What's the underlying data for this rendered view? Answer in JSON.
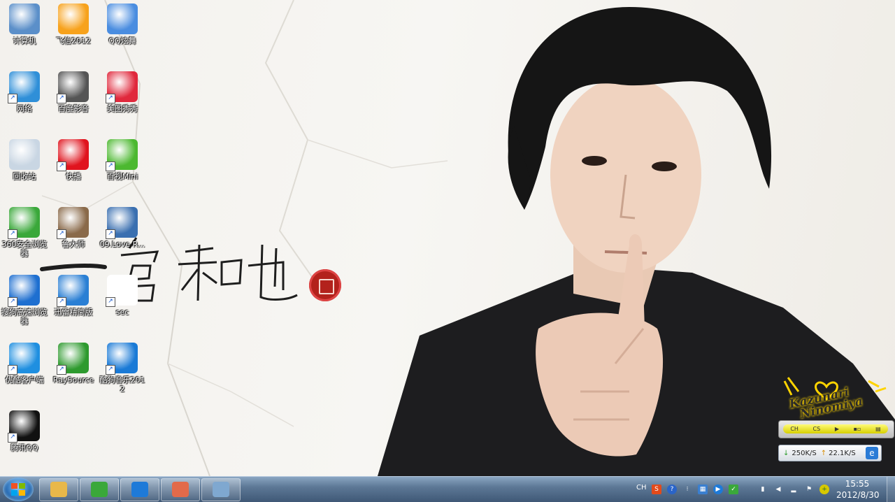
{
  "desktop": {
    "icons": [
      {
        "label": "计算机",
        "icon": "computer-icon",
        "color": "#5b8fc9"
      },
      {
        "label": "飞信2012",
        "icon": "fetion-icon",
        "color": "#f7a21c"
      },
      {
        "label": "QQ炫舞",
        "icon": "qq-dance-icon",
        "color": "#4a8de0"
      },
      {
        "label": "网络",
        "icon": "network-icon",
        "color": "#2f8fd8"
      },
      {
        "label": "百度影音",
        "icon": "baidu-player-icon",
        "color": "#555555"
      },
      {
        "label": "美图秀秀",
        "icon": "meitu-icon",
        "color": "#e0283c"
      },
      {
        "label": "回收站",
        "icon": "recycle-bin-icon",
        "color": "#c9d6e3"
      },
      {
        "label": "快播",
        "icon": "qvod-icon",
        "color": "#e0141e"
      },
      {
        "label": "百视Mini",
        "icon": "media-mini-icon",
        "color": "#4cb830"
      },
      {
        "label": "360安全浏览器",
        "icon": "browser-360-icon",
        "color": "#3aa83a"
      },
      {
        "label": "鲁大师",
        "icon": "ludashi-icon",
        "color": "#8a6a4a"
      },
      {
        "label": "09.Love R...",
        "icon": "rmvb-file-icon",
        "color": "#3a6fb0"
      },
      {
        "label": "搜狗高速浏览器",
        "icon": "sogou-browser-icon",
        "color": "#1e6fd0"
      },
      {
        "label": "迅雷精简版",
        "icon": "thunder-icon",
        "color": "#2a7fd4"
      },
      {
        "label": "sec",
        "icon": "text-file-icon",
        "color": "#ffffff"
      },
      {
        "label": "优酷客户端",
        "icon": "youku-icon",
        "color": "#1f8fe0"
      },
      {
        "label": "RaySource",
        "icon": "raysource-icon",
        "color": "#2e9a2e"
      },
      {
        "label": "酷狗音乐2012",
        "icon": "kugou-icon",
        "color": "#1a7ad6"
      },
      {
        "label": "腾讯QQ",
        "icon": "qq-icon",
        "color": "#111111"
      }
    ]
  },
  "wallpaper": {
    "signature_line1": "Kazunari",
    "signature_line2": "Ninomiya"
  },
  "widgets": {
    "media_bar_buttons": [
      "CH",
      "CS",
      "▶",
      "▪▫",
      "▤"
    ],
    "down_speed": "250K/S",
    "up_speed": "22.1K/S"
  },
  "taskbar": {
    "ime": "CH",
    "pinned": [
      {
        "name": "explorer",
        "icon": "folder-icon",
        "color": "#e8b84a"
      },
      {
        "name": "ie",
        "icon": "ie-icon",
        "color": "#3aa83a"
      },
      {
        "name": "media",
        "icon": "media-player-icon",
        "color": "#1e7ad8"
      },
      {
        "name": "users",
        "icon": "users-icon",
        "color": "#e26a4a"
      },
      {
        "name": "control",
        "icon": "control-panel-icon",
        "color": "#7fa8d0"
      }
    ],
    "time": "15:55",
    "date": "2012/8/30"
  }
}
